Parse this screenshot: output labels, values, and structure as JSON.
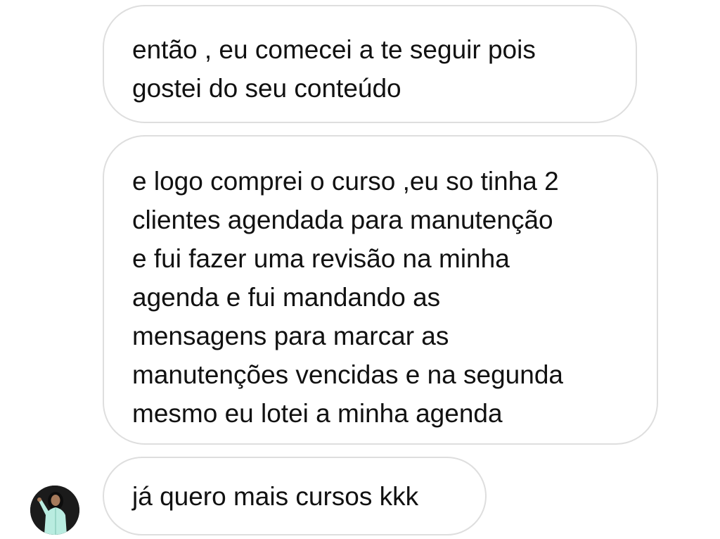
{
  "conversation": {
    "messages": [
      {
        "lines": [
          "então  , eu comecei a te seguir pois",
          "gostei do seu conteúdo"
        ]
      },
      {
        "lines": [
          "e logo comprei o curso ,eu so tinha 2",
          "clientes agendada para manutenção",
          "e fui fazer uma revisão na minha",
          "agenda e fui mandando as",
          "mensagens para marcar as",
          "manutenções vencidas e na segunda",
          "mesmo eu lotei a minha agenda"
        ]
      },
      {
        "lines": [
          "já quero mais cursos kkk"
        ]
      }
    ],
    "sender_avatar_icon": "profile-photo-avatar",
    "colors": {
      "bubble_border": "#dedede",
      "bubble_background": "#ffffff",
      "text": "#111111",
      "avatar_background": "#1b1b1b",
      "avatar_figure": "#b9ece0"
    }
  }
}
